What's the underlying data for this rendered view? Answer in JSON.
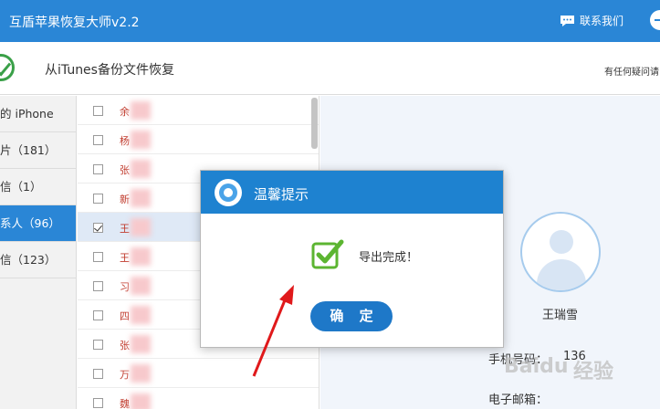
{
  "window": {
    "title": "互盾苹果恢复大师v2.2",
    "contact_label": "联系我们"
  },
  "header": {
    "title": "从iTunes备份文件恢复",
    "help_text": "有任何疑问请"
  },
  "sidebar": {
    "items": [
      {
        "label": "的 iPhone"
      },
      {
        "label": "片（181）"
      },
      {
        "label": "信（1）"
      },
      {
        "label": "系人（96）",
        "active": true
      },
      {
        "label": "信（123）"
      }
    ]
  },
  "contacts": {
    "rows": [
      {
        "name": "余",
        "checked": false
      },
      {
        "name": "杨",
        "checked": false
      },
      {
        "name": "张",
        "checked": false
      },
      {
        "name": "新",
        "checked": false
      },
      {
        "name": "王",
        "checked": true
      },
      {
        "name": "王",
        "checked": false
      },
      {
        "name": "习",
        "checked": false
      },
      {
        "name": "四",
        "checked": false
      },
      {
        "name": "张",
        "checked": false
      },
      {
        "name": "万",
        "checked": false
      },
      {
        "name": "魏",
        "checked": false
      }
    ]
  },
  "detail": {
    "name": "王瑞雪",
    "phone_label": "手机号码：",
    "phone_value": "136",
    "email_label": "电子邮箱："
  },
  "dialog": {
    "title": "温馨提示",
    "message": "导出完成！",
    "confirm_label": "确 定"
  },
  "watermark": {
    "text1": "Baidu",
    "text2": "经验"
  },
  "colors": {
    "accent": "#2a86d6",
    "dialog_header": "#1e82d0",
    "button": "#1e78c8",
    "success": "#5cb531",
    "arrow": "#e0191b"
  }
}
